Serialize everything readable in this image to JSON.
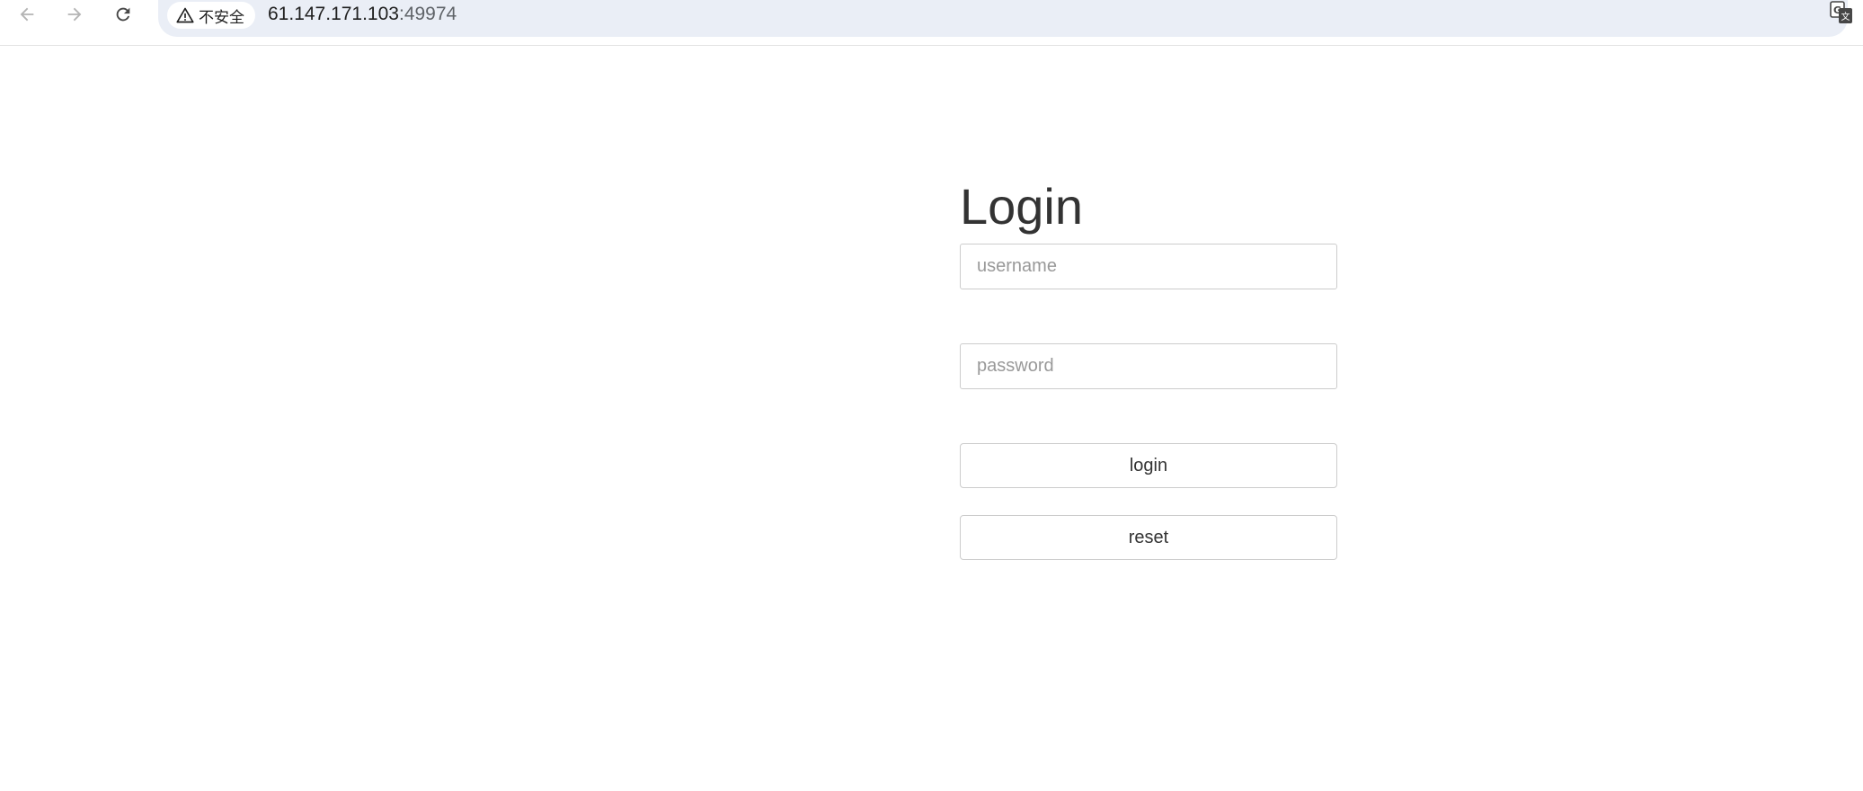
{
  "browser": {
    "security_label": "不安全",
    "url_host": "61.147.171.103",
    "url_port": ":49974",
    "icons": {
      "back": "arrow-left-icon",
      "forward": "arrow-right-icon",
      "reload": "reload-icon",
      "warning": "warning-triangle-icon",
      "translate": "translate-icon"
    }
  },
  "login": {
    "title": "Login",
    "username_placeholder": "username",
    "username_value": "",
    "password_placeholder": "password",
    "password_value": "",
    "login_label": "login",
    "reset_label": "reset"
  },
  "colors": {
    "omnibox_bg": "#eaeef6",
    "title_text": "#333333",
    "border": "#cccccc"
  }
}
